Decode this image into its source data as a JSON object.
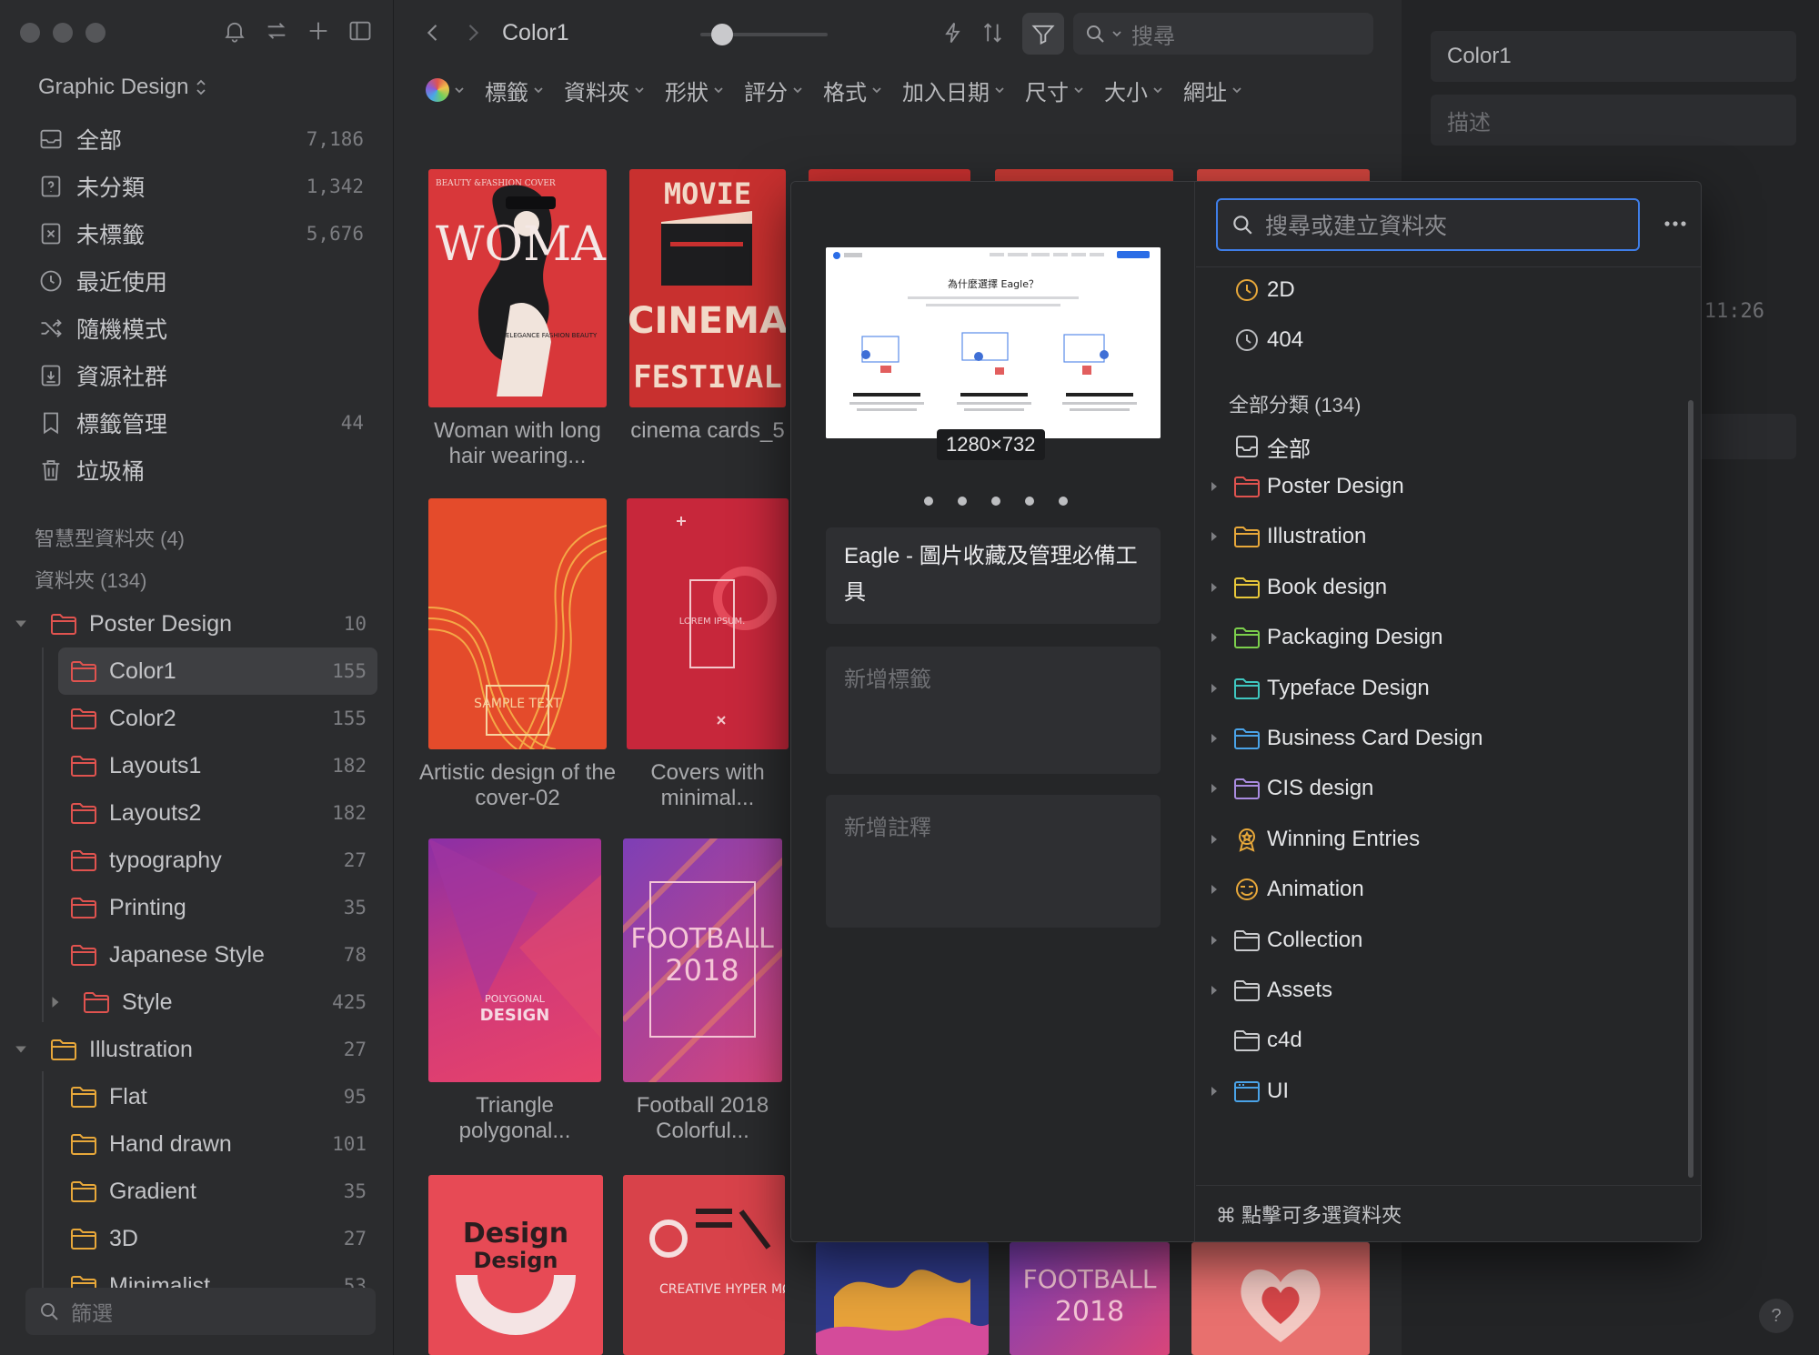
{
  "sidebar": {
    "library": "Graphic Design",
    "nav": [
      {
        "label": "全部",
        "count": "7,186",
        "icon": "inbox-icon"
      },
      {
        "label": "未分類",
        "count": "1,342",
        "icon": "question-icon"
      },
      {
        "label": "未標籤",
        "count": "5,676",
        "icon": "untagged-icon"
      },
      {
        "label": "最近使用",
        "count": "",
        "icon": "clock-icon"
      },
      {
        "label": "隨機模式",
        "count": "",
        "icon": "shuffle-icon"
      },
      {
        "label": "資源社群",
        "count": "",
        "icon": "download-icon"
      },
      {
        "label": "標籤管理",
        "count": "44",
        "icon": "bookmark-icon"
      },
      {
        "label": "垃圾桶",
        "count": "",
        "icon": "trash-icon"
      }
    ],
    "smart_folders": "智慧型資料夾 (4)",
    "folders_head": "資料夾 (134)",
    "tree": [
      {
        "label": "Poster Design",
        "count": "10",
        "level": 0,
        "expanded": true,
        "color": "#e0534f"
      },
      {
        "label": "Color1",
        "count": "155",
        "level": 1,
        "selected": true,
        "color": "#e0534f"
      },
      {
        "label": "Color2",
        "count": "155",
        "level": 1,
        "color": "#e0534f"
      },
      {
        "label": "Layouts1",
        "count": "182",
        "level": 1,
        "color": "#e0534f"
      },
      {
        "label": "Layouts2",
        "count": "182",
        "level": 1,
        "color": "#e0534f"
      },
      {
        "label": "typography",
        "count": "27",
        "level": 1,
        "color": "#e0534f"
      },
      {
        "label": "Printing",
        "count": "35",
        "level": 1,
        "color": "#e0534f"
      },
      {
        "label": "Japanese Style",
        "count": "78",
        "level": 1,
        "color": "#e0534f"
      },
      {
        "label": "Style",
        "count": "425",
        "level": 1,
        "collapsed": true,
        "color": "#e0534f"
      },
      {
        "label": "Illustration",
        "count": "27",
        "level": 0,
        "expanded": true,
        "color": "#e8a83a"
      },
      {
        "label": "Flat",
        "count": "95",
        "level": 1,
        "color": "#e8a83a"
      },
      {
        "label": "Hand drawn",
        "count": "101",
        "level": 1,
        "color": "#e8a83a"
      },
      {
        "label": "Gradient",
        "count": "35",
        "level": 1,
        "color": "#e8a83a"
      },
      {
        "label": "3D",
        "count": "27",
        "level": 1,
        "color": "#e8a83a"
      },
      {
        "label": "Minimalist",
        "count": "53",
        "level": 1,
        "color": "#e8a83a"
      }
    ],
    "filter_placeholder": "篩選"
  },
  "toolbar": {
    "breadcrumb": "Color1",
    "zoom": 0.1,
    "search_placeholder": "搜尋"
  },
  "filters": [
    "標籤",
    "資料夾",
    "形狀",
    "評分",
    "格式",
    "加入日期",
    "尺寸",
    "大小",
    "網址"
  ],
  "cards": [
    {
      "title": "Woman with long hair wearing..."
    },
    {
      "title": "cinema cards_5"
    },
    {
      "title": "Artistic design of the cover-02"
    },
    {
      "title": "Covers with minimal..."
    },
    {
      "title": "Triangle polygonal..."
    },
    {
      "title": "Football 2018 Colorful..."
    }
  ],
  "thumb_text": {
    "beauty": "BEAUTY &FASHION COVER",
    "woman": "WOMAN",
    "elegance": "ELEGANCE FASHION BEAUTY",
    "movie": "MOVIE",
    "cinema": "CINEMA",
    "festival": "FESTIVAL",
    "sample": "SAMPLE TEXT",
    "lorem": "LOREM IPSUM.",
    "polygonal": "POLYGONAL",
    "design": "DESIGN",
    "football": "FOOTBALL",
    "year": "2018",
    "design_title": "Design",
    "design_sub": "Design",
    "creative": "CREATIVE HYPER MØDERN"
  },
  "inspector": {
    "name": "Color1",
    "desc_placeholder": "描述",
    "time": "11:26",
    "help": "?"
  },
  "popup": {
    "preview_heading": "為什麼選擇 Eagle？",
    "dimensions": "1280×732",
    "title": "Eagle - 圖片收藏及管理必備工具",
    "tags_placeholder": "新增標籤",
    "notes_placeholder": "新增註釋",
    "search_placeholder": "搜尋或建立資料夾",
    "recent": [
      {
        "label": "2D",
        "icon_color": "#e8a83a"
      },
      {
        "label": "404",
        "icon_color": "#b9babd"
      }
    ],
    "all_head": "全部分類 (134)",
    "all_label": "全部",
    "folders": [
      {
        "label": "Poster Design",
        "color": "#e0534f",
        "icon": "folder-icon",
        "caret": true
      },
      {
        "label": "Illustration",
        "color": "#e8a83a",
        "icon": "folder-icon",
        "caret": true
      },
      {
        "label": "Book design",
        "color": "#e8c83a",
        "icon": "folder-icon",
        "caret": true
      },
      {
        "label": "Packaging Design",
        "color": "#7ccf4c",
        "icon": "folder-icon",
        "caret": true
      },
      {
        "label": "Typeface Design",
        "color": "#3fc7c0",
        "icon": "folder-icon",
        "caret": true
      },
      {
        "label": "Business Card Design",
        "color": "#4aa3e8",
        "icon": "folder-icon",
        "caret": true
      },
      {
        "label": "CIS design",
        "color": "#a98be0",
        "icon": "folder-icon",
        "caret": true
      },
      {
        "label": "Winning Entries",
        "color": "#e8a83a",
        "icon": "award-icon",
        "caret": true
      },
      {
        "label": "Animation",
        "color": "#e8a83a",
        "icon": "smiley-icon",
        "caret": true
      },
      {
        "label": "Collection",
        "color": "#c9cacd",
        "icon": "folder-icon",
        "caret": true
      },
      {
        "label": "Assets",
        "color": "#c9cacd",
        "icon": "folder-icon",
        "caret": true
      },
      {
        "label": "c4d",
        "color": "#c9cacd",
        "icon": "folder-icon",
        "caret": false
      },
      {
        "label": "UI",
        "color": "#4aa3e8",
        "icon": "window-icon",
        "caret": true
      }
    ],
    "footer": "⌘ 點擊可多選資料夾"
  }
}
